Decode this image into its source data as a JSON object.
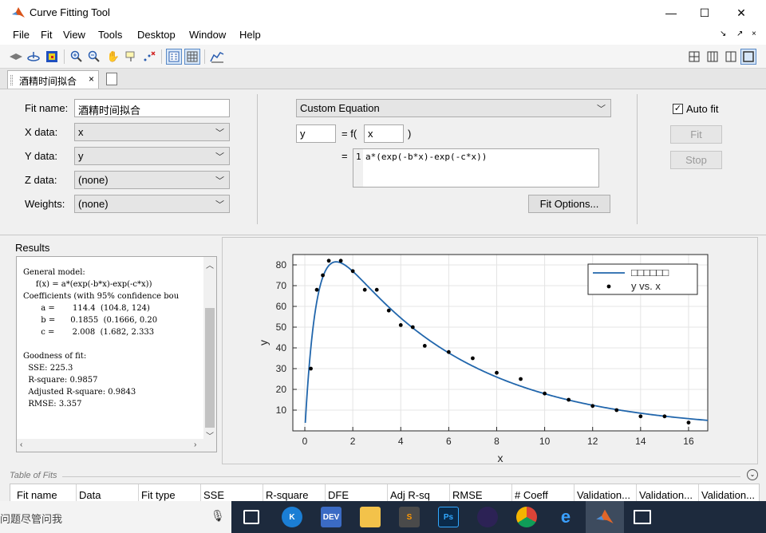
{
  "window": {
    "title": "Curve Fitting Tool",
    "minimize_glyph": "—",
    "maximize_glyph": "☐",
    "close_glyph": "✕"
  },
  "menu": {
    "items": [
      "File",
      "Fit",
      "View",
      "Tools",
      "Desktop",
      "Window",
      "Help"
    ],
    "right_glyphs": [
      "↘",
      "↗",
      "×"
    ]
  },
  "toolbar": {
    "icons": [
      "move-icon",
      "rotate-3d-icon",
      "color-map-icon",
      "zoom-in-icon",
      "zoom-out-icon",
      "pan-hand-icon",
      "data-cursor-icon",
      "exclude-outliers-icon",
      "legend-icon",
      "grid-icon",
      "residuals-icon"
    ],
    "layout_icons": [
      "layout-quad-icon",
      "layout-columns-icon",
      "layout-split-icon",
      "layout-single-icon"
    ]
  },
  "tabs": [
    {
      "label": "酒精时间拟合",
      "close_glyph": "×"
    }
  ],
  "fit": {
    "fit_name_label": "Fit name:",
    "fit_name_value": "酒精时间拟合",
    "x_data_label": "X data:",
    "x_data_value": "x",
    "y_data_label": "Y data:",
    "y_data_value": "y",
    "z_data_label": "Z data:",
    "z_data_value": "(none)",
    "weights_label": "Weights:",
    "weights_value": "(none)",
    "fit_type": "Custom Equation",
    "dependent_var": "y",
    "equals_f": "= f(",
    "independent_var": "x",
    "close_paren": ")",
    "equals": "=",
    "equation_line_number": "1",
    "equation": "a*(exp(-b*x)-exp(-c*x))",
    "fit_options_label": "Fit Options...",
    "auto_fit_label": "Auto fit",
    "auto_fit_checked": true,
    "fit_button_label": "Fit",
    "stop_button_label": "Stop"
  },
  "results": {
    "heading": "Results",
    "lines": [
      "General model:",
      "     f(x) = a*(exp(-b*x)-exp(-c*x))",
      "Coefficients (with 95% confidence bou",
      "       a =       114.4  (104.8, 124)",
      "       b =      0.1855  (0.1666, 0.20",
      "       c =       2.008  (1.682, 2.333",
      "",
      "Goodness of fit:",
      "  SSE: 225.3",
      "  R-square: 0.9857",
      "  Adjusted R-square: 0.9843",
      "  RMSE: 3.357"
    ]
  },
  "table_of_fits": {
    "title": "Table of Fits",
    "columns": [
      "Fit name",
      "Data",
      "Fit type",
      "SSE",
      "R-square",
      "DFE",
      "Adj R-sq",
      "RMSE",
      "# Coeff",
      "Validation...",
      "Validation...",
      "Validation..."
    ]
  },
  "taskbar": {
    "search_placeholder": "问题尽管问我",
    "apps": [
      "cortana",
      "dev-c++",
      "file-explorer",
      "sublime-text",
      "photoshop",
      "eclipse",
      "chrome",
      "edge",
      "matlab",
      "photos"
    ],
    "app_labels": [
      "K",
      "DEV",
      "",
      "S",
      "Ps",
      "",
      "",
      "e",
      "",
      ""
    ]
  },
  "chart_data": {
    "type": "scatter",
    "xlabel": "x",
    "ylabel": "y",
    "xlim": [
      -0.5,
      16.8
    ],
    "ylim": [
      0,
      85
    ],
    "x_ticks": [
      0,
      2,
      4,
      6,
      8,
      10,
      12,
      14,
      16
    ],
    "y_ticks": [
      10,
      20,
      30,
      40,
      50,
      60,
      70,
      80
    ],
    "grid": true,
    "legend_position": "top-right",
    "series": [
      {
        "name": "□□□□□□",
        "kind": "fitted-curve",
        "model": "a*(exp(-b*x)-exp(-c*x))",
        "coefficients": {
          "a": 114.4,
          "b": 0.1855,
          "c": 2.008
        },
        "color": "#2166ac"
      },
      {
        "name": "y vs. x",
        "kind": "points",
        "color": "#000000",
        "points": [
          [
            0.25,
            30
          ],
          [
            0.5,
            68
          ],
          [
            0.75,
            75
          ],
          [
            1,
            82
          ],
          [
            1.5,
            82
          ],
          [
            2,
            77
          ],
          [
            2.5,
            68
          ],
          [
            3,
            68
          ],
          [
            3.5,
            58
          ],
          [
            4,
            51
          ],
          [
            4.5,
            50
          ],
          [
            5,
            41
          ],
          [
            6,
            38
          ],
          [
            7,
            35
          ],
          [
            8,
            28
          ],
          [
            9,
            25
          ],
          [
            10,
            18
          ],
          [
            11,
            15
          ],
          [
            12,
            12
          ],
          [
            13,
            10
          ],
          [
            14,
            7
          ],
          [
            15,
            7
          ],
          [
            16,
            4
          ]
        ]
      }
    ]
  }
}
